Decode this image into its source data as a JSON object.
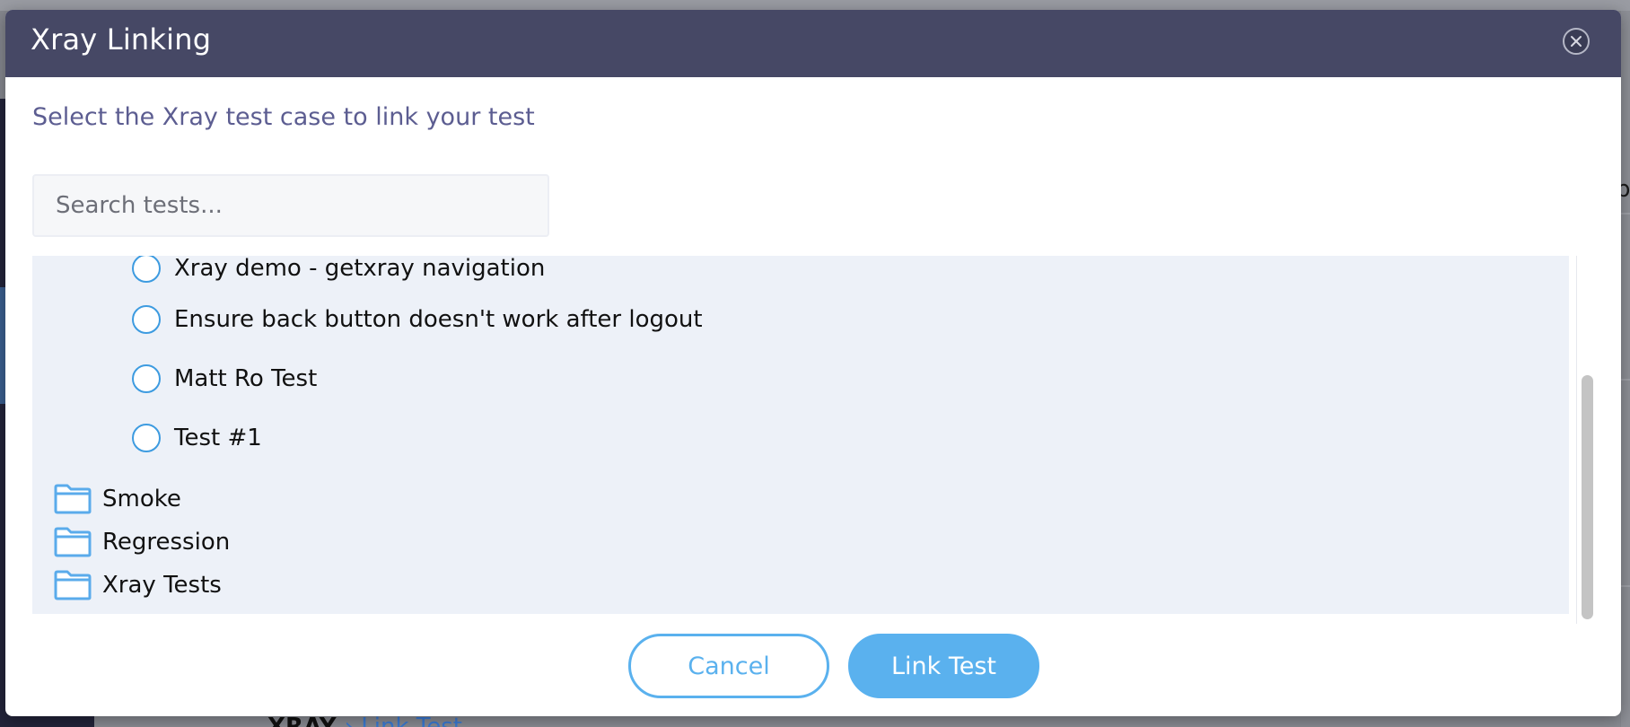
{
  "dialog": {
    "title": "Xray Linking",
    "subtitle": "Select the Xray test case to link your test",
    "close_icon": "close-circle-icon"
  },
  "search": {
    "placeholder": "Search tests...",
    "value": ""
  },
  "tree": {
    "tests": [
      {
        "label": "Xray demo - getxray navigation"
      },
      {
        "label": "Ensure back button doesn't work after logout"
      },
      {
        "label": "Matt Ro Test"
      },
      {
        "label": "Test #1"
      }
    ],
    "folders": [
      {
        "label": "Smoke",
        "icon": "folder-icon"
      },
      {
        "label": "Regression",
        "icon": "folder-icon"
      },
      {
        "label": "Xray Tests",
        "icon": "folder-icon"
      }
    ]
  },
  "actions": {
    "cancel_label": "Cancel",
    "link_label": "Link Test"
  },
  "background": {
    "peek_char": "p",
    "bottom_logo": "XRAY",
    "bottom_crumb": "› Link Test"
  },
  "colors": {
    "header_bg": "#464865",
    "accent": "#5ab1ee",
    "subtitle": "#5c5d91",
    "tree_bg": "#edf1f8",
    "folder": "#5aabeb"
  }
}
